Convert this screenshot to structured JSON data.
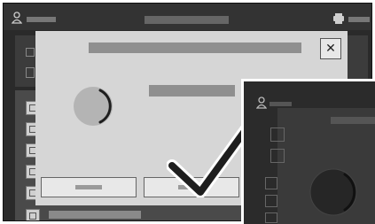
{
  "app": {
    "colors": {
      "frame": "#2a2a2a",
      "modal": "#d6d6d6",
      "placeholder": "#8f8f8f",
      "checkmark": "#1e1e1e"
    }
  },
  "header": {
    "user_icon": "user-icon",
    "printer_icon": "printer-icon"
  },
  "modal": {
    "close_icon": "close-icon",
    "close_glyph": "✕",
    "status_icon": "checkmark-icon",
    "spinner_icon": "loading-spinner-icon"
  },
  "sidebar": {
    "items": [
      {
        "icon": "document-icon"
      },
      {
        "icon": "copy-icon"
      },
      {
        "icon": "scan-icon"
      },
      {
        "icon": "list-icon"
      },
      {
        "icon": "settings-icon"
      },
      {
        "icon": "home-icon"
      }
    ]
  },
  "preview": {
    "user_icon": "user-icon",
    "spinner_icon": "loading-spinner-icon"
  }
}
